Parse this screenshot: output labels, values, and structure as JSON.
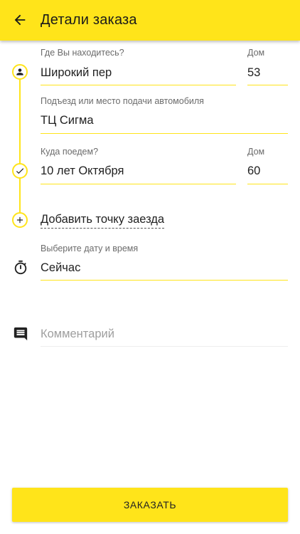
{
  "header": {
    "title": "Детали заказа",
    "back_icon": "arrow-back-icon"
  },
  "from": {
    "label": "Где Вы находитесь?",
    "street": "Широкий пер",
    "house_label": "Дом",
    "house": "53",
    "icon": "person-icon"
  },
  "entrance": {
    "label": "Подъезд или место подачи автомобиля",
    "value": "ТЦ Сигма"
  },
  "to": {
    "label": "Куда поедем?",
    "street": "10 лет Октября",
    "house_label": "Дом",
    "house": "60",
    "icon": "check-icon"
  },
  "add_stop": {
    "label": "Добавить точку заезда",
    "icon": "plus-icon"
  },
  "datetime": {
    "label": "Выберите дату и время",
    "value": "Сейчас",
    "icon": "stopwatch-icon"
  },
  "comment": {
    "placeholder": "Комментарий",
    "icon": "comment-icon"
  },
  "order_button": {
    "label": "ЗАКАЗАТЬ"
  },
  "colors": {
    "accent": "#FFE41A",
    "text": "#212121",
    "label": "#6b6b6b",
    "placeholder": "#9e9e9e"
  }
}
